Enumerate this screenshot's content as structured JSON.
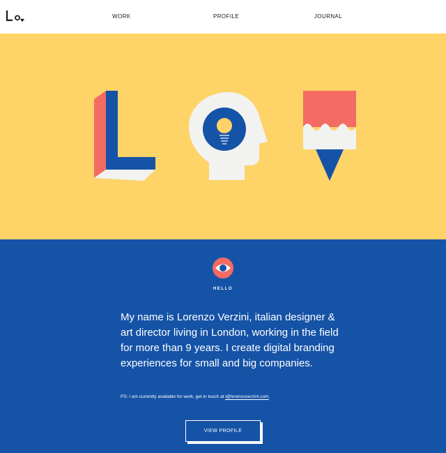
{
  "header": {
    "nav": [
      {
        "label": "WORK"
      },
      {
        "label": "PROFILE"
      },
      {
        "label": "JOURNAL"
      }
    ]
  },
  "colors": {
    "yellow": "#fed368",
    "blue": "#1553a7",
    "coral": "#f46b63",
    "white": "#ffffff",
    "offwhite": "#f2f2f0"
  },
  "hero": {
    "illustrations": [
      "letter-l-illustration",
      "head-lightbulb-illustration",
      "pencil-illustration"
    ]
  },
  "intro": {
    "section_label": "HELLO",
    "bio": "My name is Lorenzo Verzini, italian designer & art director living in London, working in the field for more than 9 years. I create digital branding experiences for small and big companies.",
    "ps_text": "PS: I am currently available for work, get in touch at ",
    "email": "l@lorenzoverzini.com",
    "ps_suffix": ".",
    "button_label": "VIEW PROFILE"
  }
}
